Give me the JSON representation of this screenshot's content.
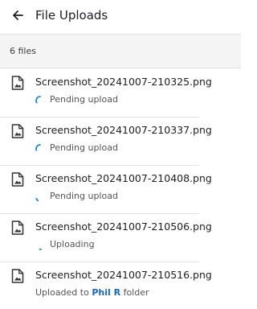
{
  "header": {
    "title": "File Uploads",
    "back_icon": "arrow-left-icon"
  },
  "summary": {
    "count_text": "6 files"
  },
  "colors": {
    "accent": "#1e88c8",
    "link": "#1565c0",
    "muted_text": "#555555"
  },
  "files": [
    {
      "name": "Screenshot_20241007-210325.png",
      "status": "Pending upload",
      "state": "pending",
      "icon": "image-file-icon"
    },
    {
      "name": "Screenshot_20241007-210337.png",
      "status": "Pending upload",
      "state": "pending",
      "icon": "image-file-icon"
    },
    {
      "name": "Screenshot_20241007-210408.png",
      "status": "Pending upload",
      "state": "pending",
      "icon": "image-file-icon"
    },
    {
      "name": "Screenshot_20241007-210506.png",
      "status": "Uploading",
      "state": "uploading",
      "icon": "image-file-icon"
    },
    {
      "name": "Screenshot_20241007-210516.png",
      "status_prefix": "Uploaded to ",
      "status_link": "Phil R",
      "status_suffix": " folder",
      "state": "done",
      "icon": "image-file-icon"
    }
  ]
}
